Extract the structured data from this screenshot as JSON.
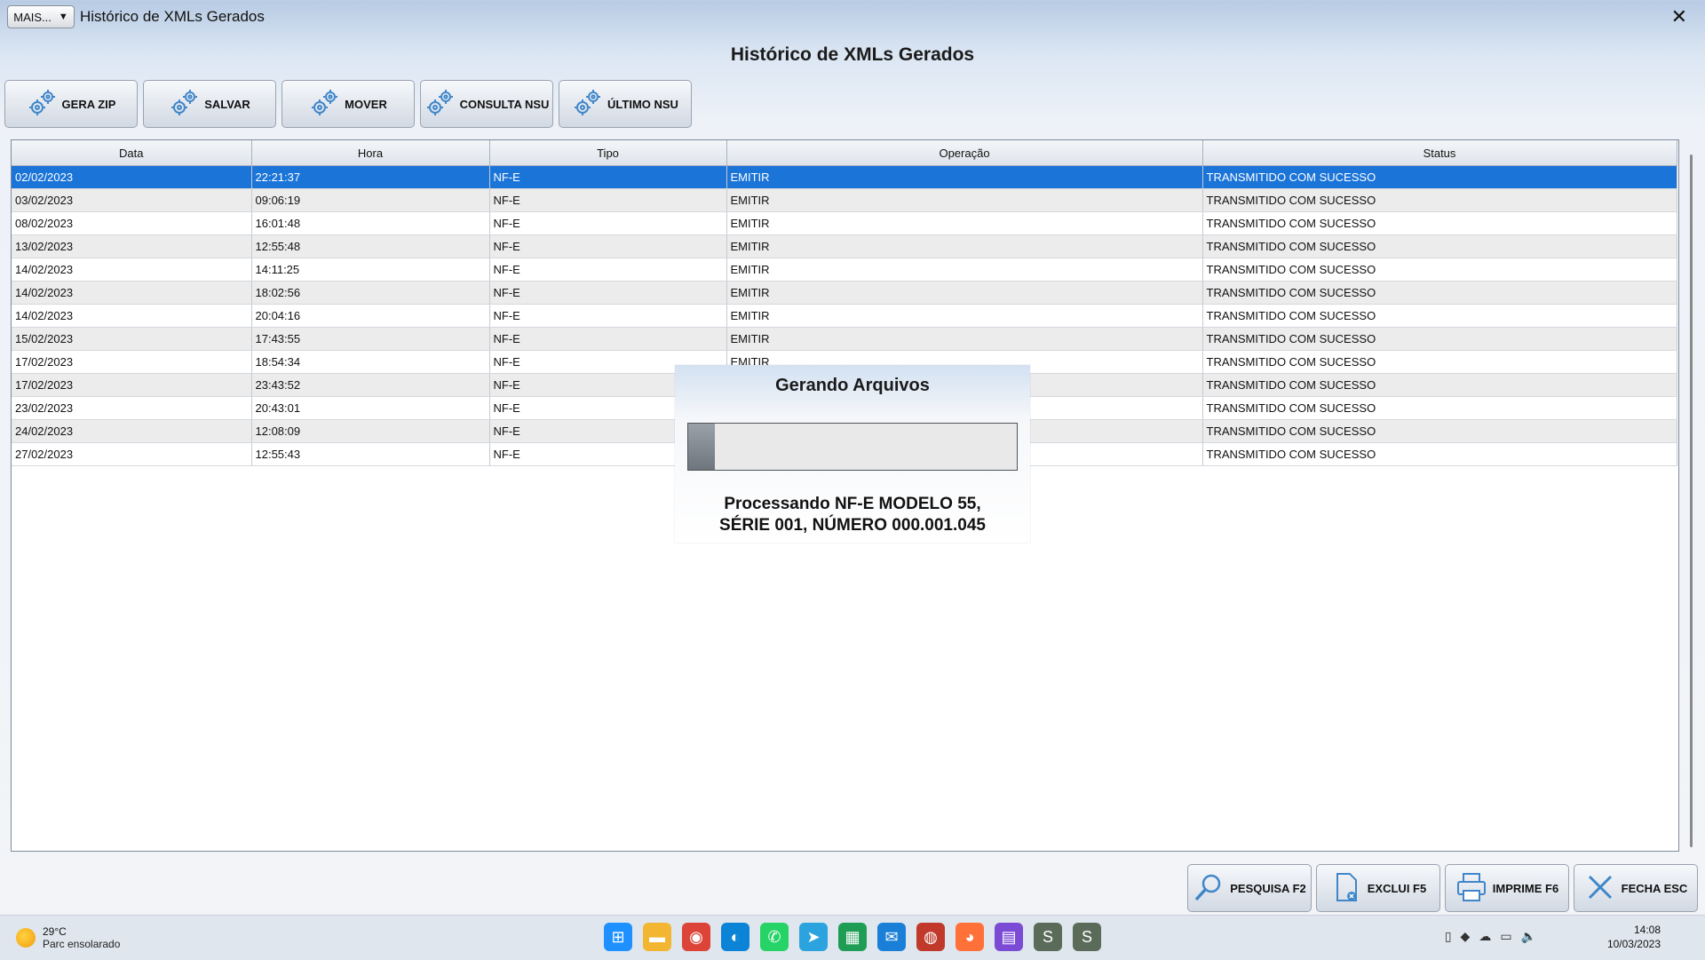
{
  "window": {
    "mais_label": "MAIS...",
    "title": "Histórico de XMLs Gerados",
    "close_glyph": "✕",
    "main_title": "Histórico de XMLs Gerados"
  },
  "toolbar": {
    "buttons": [
      {
        "label": "GERA ZIP",
        "icon": "gear-icon"
      },
      {
        "label": "SALVAR",
        "icon": "gear-icon"
      },
      {
        "label": "MOVER",
        "icon": "gear-icon"
      },
      {
        "label": "CONSULTA NSU",
        "icon": "gear-icon"
      },
      {
        "label": "ÚLTIMO NSU",
        "icon": "gear-icon"
      }
    ]
  },
  "table": {
    "columns": [
      "Data",
      "Hora",
      "Tipo",
      "Operação",
      "Status"
    ],
    "rows": [
      [
        "02/02/2023",
        "22:21:37",
        "NF-E",
        "EMITIR",
        "TRANSMITIDO COM SUCESSO"
      ],
      [
        "03/02/2023",
        "09:06:19",
        "NF-E",
        "EMITIR",
        "TRANSMITIDO COM SUCESSO"
      ],
      [
        "08/02/2023",
        "16:01:48",
        "NF-E",
        "EMITIR",
        "TRANSMITIDO COM SUCESSO"
      ],
      [
        "13/02/2023",
        "12:55:48",
        "NF-E",
        "EMITIR",
        "TRANSMITIDO COM SUCESSO"
      ],
      [
        "14/02/2023",
        "14:11:25",
        "NF-E",
        "EMITIR",
        "TRANSMITIDO COM SUCESSO"
      ],
      [
        "14/02/2023",
        "18:02:56",
        "NF-E",
        "EMITIR",
        "TRANSMITIDO COM SUCESSO"
      ],
      [
        "14/02/2023",
        "20:04:16",
        "NF-E",
        "EMITIR",
        "TRANSMITIDO COM SUCESSO"
      ],
      [
        "15/02/2023",
        "17:43:55",
        "NF-E",
        "EMITIR",
        "TRANSMITIDO COM SUCESSO"
      ],
      [
        "17/02/2023",
        "18:54:34",
        "NF-E",
        "EMITIR",
        "TRANSMITIDO COM SUCESSO"
      ],
      [
        "17/02/2023",
        "23:43:52",
        "NF-E",
        "",
        "TRANSMITIDO COM SUCESSO"
      ],
      [
        "23/02/2023",
        "20:43:01",
        "NF-E",
        "",
        "TRANSMITIDO COM SUCESSO"
      ],
      [
        "24/02/2023",
        "12:08:09",
        "NF-E",
        "",
        "TRANSMITIDO COM SUCESSO"
      ],
      [
        "27/02/2023",
        "12:55:43",
        "NF-E",
        "",
        "TRANSMITIDO COM SUCESSO"
      ]
    ],
    "selected_row": 0
  },
  "dialog": {
    "title": "Gerando Arquivos",
    "progress": 0.08,
    "message_line1": "Processando NF-E MODELO 55,",
    "message_line2": "SÉRIE 001, NÚMERO 000.001.045"
  },
  "bottom_buttons": [
    {
      "label": "PESQUISA F2",
      "icon": "magnifier-icon"
    },
    {
      "label": "EXCLUI F5",
      "icon": "delete-document-icon"
    },
    {
      "label": "IMPRIME F6",
      "icon": "printer-icon"
    },
    {
      "label": "FECHA ESC",
      "icon": "close-icon"
    }
  ],
  "taskbar": {
    "weather_temp": "29°C",
    "weather_desc": "Parc ensolarado",
    "time": "14:08",
    "date": "10/03/2023",
    "apps": [
      "windows-start-icon",
      "file-explorer-icon",
      "chrome-icon",
      "edge-icon",
      "whatsapp-icon",
      "telegram-icon",
      "spreadsheet-icon",
      "mail-icon",
      "app-icon",
      "firefox-icon",
      "media-icon",
      "erp-app-icon",
      "erp-app-icon-2"
    ]
  }
}
